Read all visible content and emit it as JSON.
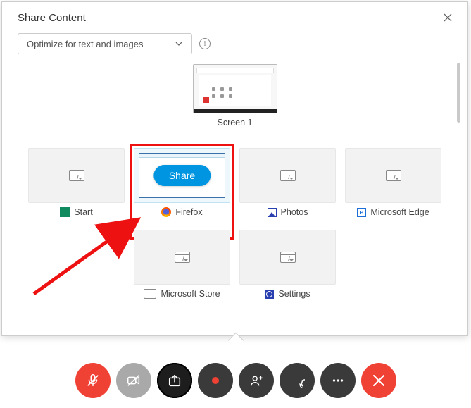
{
  "dialog": {
    "title": "Share Content",
    "dropdown_value": "Optimize for text and images"
  },
  "screen": {
    "label": "Screen 1"
  },
  "apps": {
    "start": "Start",
    "firefox": "Firefox",
    "photos": "Photos",
    "edge": "Microsoft Edge",
    "store": "Microsoft Store",
    "settings": "Settings"
  },
  "share_button": "Share",
  "edge_glyph": "e"
}
